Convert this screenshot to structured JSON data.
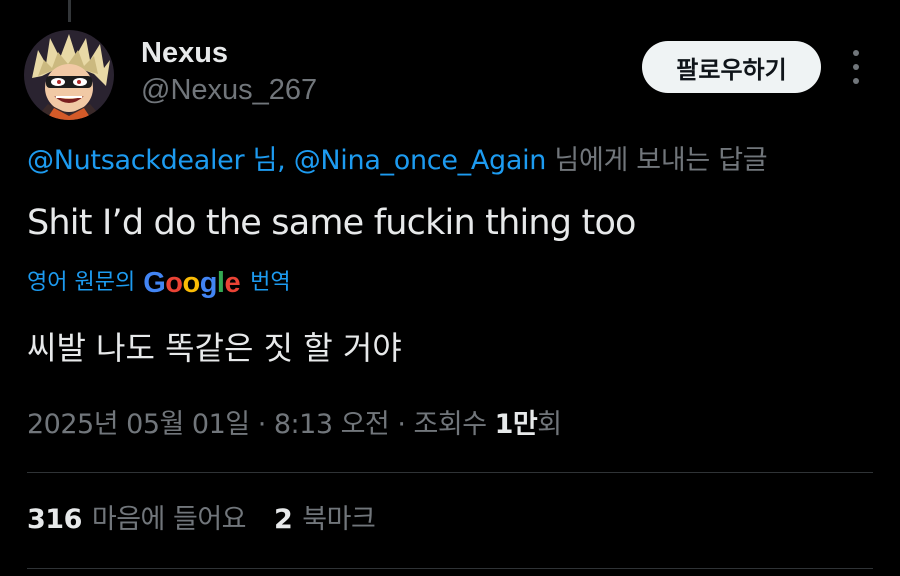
{
  "tweet": {
    "author": {
      "name": "Nexus",
      "handle": "@Nexus_267",
      "avatar_icon": "anime-avatar-icon"
    },
    "follow_label": "팔로우하기",
    "reply_to": {
      "mention1": "@Nutsackdealer",
      "sep1": " 님, ",
      "mention2": "@Nina_once_Again",
      "suffix": " 님에게 보내는 답글"
    },
    "text": "Shit I’d do the same fuckin thing too",
    "translation": {
      "prefix": "영어 원문의",
      "brand": "Google",
      "suffix": "번역",
      "text": "씨발 나도 똑같은 짓 할 거야"
    },
    "meta": {
      "date": "2025년 05월 01일",
      "dot1": " · ",
      "time": "8:13 오전",
      "dot2": " · ",
      "views_label": "조회수 ",
      "views_value": "1만",
      "views_unit": "회"
    },
    "stats": {
      "likes_count": "316",
      "likes_label": "마음에 들어요",
      "bookmarks_count": "2",
      "bookmarks_label": "북마크"
    },
    "colors": {
      "background": "#000000",
      "text": "#e7e9ea",
      "muted": "#71767b",
      "link": "#1d9bf0",
      "divider": "#2f3336"
    }
  }
}
